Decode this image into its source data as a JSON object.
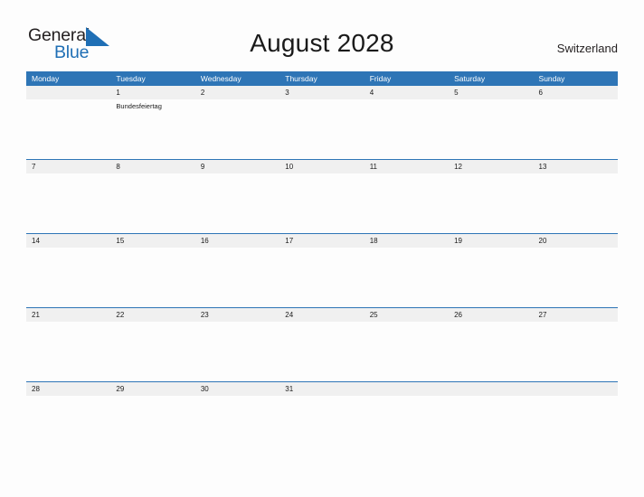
{
  "brand": {
    "name_part1": "General",
    "name_part2": "Blue",
    "flag_icon": "blue-triangle-flag-icon",
    "accent_color": "#1f6fb5"
  },
  "header": {
    "title": "August 2028",
    "country": "Switzerland"
  },
  "colors": {
    "header_blue": "#2e75b6",
    "date_row_gray": "#f0f0f0",
    "page_background": "#fdfdfd",
    "text": "#1a1a1a"
  },
  "calendar": {
    "month": "August",
    "year": "2028",
    "weekday_headers": [
      "Monday",
      "Tuesday",
      "Wednesday",
      "Thursday",
      "Friday",
      "Saturday",
      "Sunday"
    ],
    "weeks": [
      {
        "days": [
          {
            "date": "",
            "events": []
          },
          {
            "date": "1",
            "events": [
              "Bundesfeiertag"
            ]
          },
          {
            "date": "2",
            "events": []
          },
          {
            "date": "3",
            "events": []
          },
          {
            "date": "4",
            "events": []
          },
          {
            "date": "5",
            "events": []
          },
          {
            "date": "6",
            "events": []
          }
        ]
      },
      {
        "days": [
          {
            "date": "7",
            "events": []
          },
          {
            "date": "8",
            "events": []
          },
          {
            "date": "9",
            "events": []
          },
          {
            "date": "10",
            "events": []
          },
          {
            "date": "11",
            "events": []
          },
          {
            "date": "12",
            "events": []
          },
          {
            "date": "13",
            "events": []
          }
        ]
      },
      {
        "days": [
          {
            "date": "14",
            "events": []
          },
          {
            "date": "15",
            "events": []
          },
          {
            "date": "16",
            "events": []
          },
          {
            "date": "17",
            "events": []
          },
          {
            "date": "18",
            "events": []
          },
          {
            "date": "19",
            "events": []
          },
          {
            "date": "20",
            "events": []
          }
        ]
      },
      {
        "days": [
          {
            "date": "21",
            "events": []
          },
          {
            "date": "22",
            "events": []
          },
          {
            "date": "23",
            "events": []
          },
          {
            "date": "24",
            "events": []
          },
          {
            "date": "25",
            "events": []
          },
          {
            "date": "26",
            "events": []
          },
          {
            "date": "27",
            "events": []
          }
        ]
      },
      {
        "days": [
          {
            "date": "28",
            "events": []
          },
          {
            "date": "29",
            "events": []
          },
          {
            "date": "30",
            "events": []
          },
          {
            "date": "31",
            "events": []
          },
          {
            "date": "",
            "events": []
          },
          {
            "date": "",
            "events": []
          },
          {
            "date": "",
            "events": []
          }
        ]
      }
    ]
  }
}
